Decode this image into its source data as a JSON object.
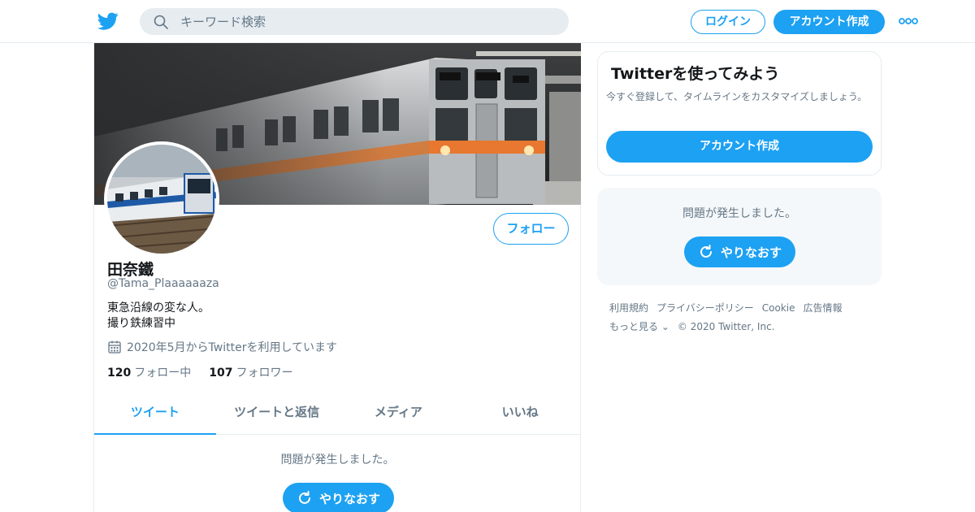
{
  "header": {
    "logo_icon": "twitter-bird-icon",
    "search_placeholder": "キーワード検索",
    "login_label": "ログイン",
    "signup_label": "アカウント作成",
    "more_icon": "more-dots-icon"
  },
  "profile": {
    "name": "田奈鐵",
    "handle": "@Tama_Plaaaaaaza",
    "bio_line1": "東急沿線の変な人。",
    "bio_line2": "撮り鉄練習中",
    "joined": "2020年5月からTwitterを利用しています",
    "follow_label": "フォロー",
    "following_count": "120",
    "following_label": "フォロー中",
    "followers_count": "107",
    "followers_label": "フォロワー",
    "banner_image": "train-in-station-photo",
    "avatar_image": "blue-train-photo"
  },
  "tabs": [
    {
      "label": "ツイート",
      "active": true
    },
    {
      "label": "ツイートと返信",
      "active": false
    },
    {
      "label": "メディア",
      "active": false
    },
    {
      "label": "いいね",
      "active": false
    }
  ],
  "timeline": {
    "error_text": "問題が発生しました。",
    "retry_label": "やりなおす"
  },
  "sidebar": {
    "promo_title": "Twitterを使ってみよう",
    "promo_text": "今すぐ登録して、タイムラインをカスタマイズしましょう。",
    "promo_button": "アカウント作成",
    "error_text": "問題が発生しました。",
    "retry_label": "やりなおす"
  },
  "footer": {
    "links": [
      "利用規約",
      "プライバシーポリシー",
      "Cookie",
      "広告情報"
    ],
    "more_label": "もっと見る",
    "copyright": "© 2020 Twitter, Inc."
  },
  "colors": {
    "accent": "#1da1f2",
    "text_secondary": "#657786",
    "border": "#e6ecf0"
  }
}
